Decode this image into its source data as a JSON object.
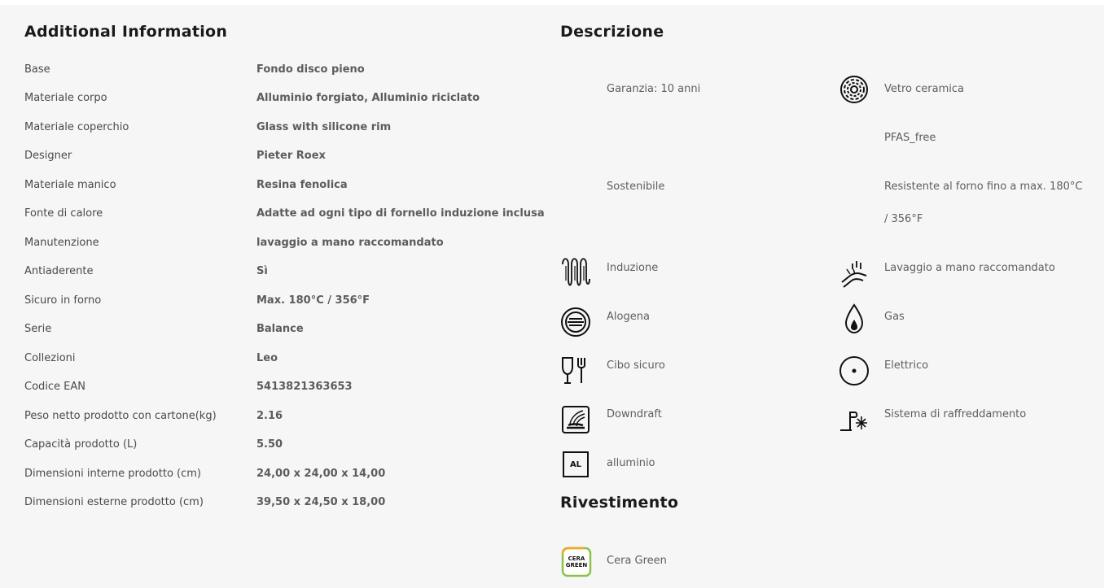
{
  "additional_info": {
    "title": "Additional Information",
    "rows": [
      {
        "label": "Base",
        "value": "Fondo disco pieno"
      },
      {
        "label": "Materiale corpo",
        "value": "Alluminio forgiato, Alluminio riciclato"
      },
      {
        "label": "Materiale coperchio",
        "value": "Glass with silicone rim"
      },
      {
        "label": "Designer",
        "value": "Pieter Roex"
      },
      {
        "label": "Materiale manico",
        "value": "Resina fenolica"
      },
      {
        "label": "Fonte di calore",
        "value": "Adatte ad ogni tipo di fornello induzione inclusa"
      },
      {
        "label": "Manutenzione",
        "value": "lavaggio a mano raccomandato"
      },
      {
        "label": "Antiaderente",
        "value": "Sì"
      },
      {
        "label": "Sicuro in forno",
        "value": "Max. 180°C / 356°F"
      },
      {
        "label": "Serie",
        "value": "Balance"
      },
      {
        "label": "Collezioni",
        "value": "Leo"
      },
      {
        "label": "Codice EAN",
        "value": "5413821363653"
      },
      {
        "label": "Peso netto prodotto con cartone(kg)",
        "value": "2.16"
      },
      {
        "label": "Capacità prodotto (L)",
        "value": "5.50"
      },
      {
        "label": "Dimensioni interne prodotto (cm)",
        "value": "24,00 x 24,00 x 14,00"
      },
      {
        "label": "Dimensioni esterne prodotto (cm)",
        "value": "39,50 x 24,50 x 18,00"
      }
    ]
  },
  "descrizione": {
    "title": "Descrizione",
    "features": {
      "garanzia": {
        "text": "Garanzia: 10 anni"
      },
      "vetro_ceramica": {
        "text": "Vetro ceramica",
        "icon": "ceramic-hob-icon"
      },
      "pfas_free": {
        "text": "PFAS_free"
      },
      "sostenibile": {
        "text": "Sostenibile"
      },
      "resistente_forno": {
        "text": "Resistente al forno fino a max. 180°C / 356°F"
      },
      "induzione": {
        "text": "Induzione",
        "icon": "induction-coil-icon"
      },
      "lavaggio_mano": {
        "text": "Lavaggio a mano raccomandato",
        "icon": "hand-wash-icon"
      },
      "alogena": {
        "text": "Alogena",
        "icon": "halogen-hob-icon"
      },
      "gas": {
        "text": "Gas",
        "icon": "gas-flame-icon"
      },
      "cibo_sicuro": {
        "text": "Cibo sicuro",
        "icon": "food-safe-icon"
      },
      "elettrico": {
        "text": "Elettrico",
        "icon": "electric-hob-icon"
      },
      "downdraft": {
        "text": "Downdraft",
        "icon": "downdraft-icon"
      },
      "raffreddamento": {
        "text": "Sistema di raffreddamento",
        "icon": "cooling-system-icon"
      },
      "alluminio": {
        "text": "alluminio",
        "icon_text": "AL"
      }
    }
  },
  "rivestimento": {
    "title": "Rivestimento",
    "coating": {
      "text": "Cera Green",
      "logo_line1": "CERA",
      "logo_line2": "GREEN",
      "accent_color": "#8bc34a"
    }
  }
}
